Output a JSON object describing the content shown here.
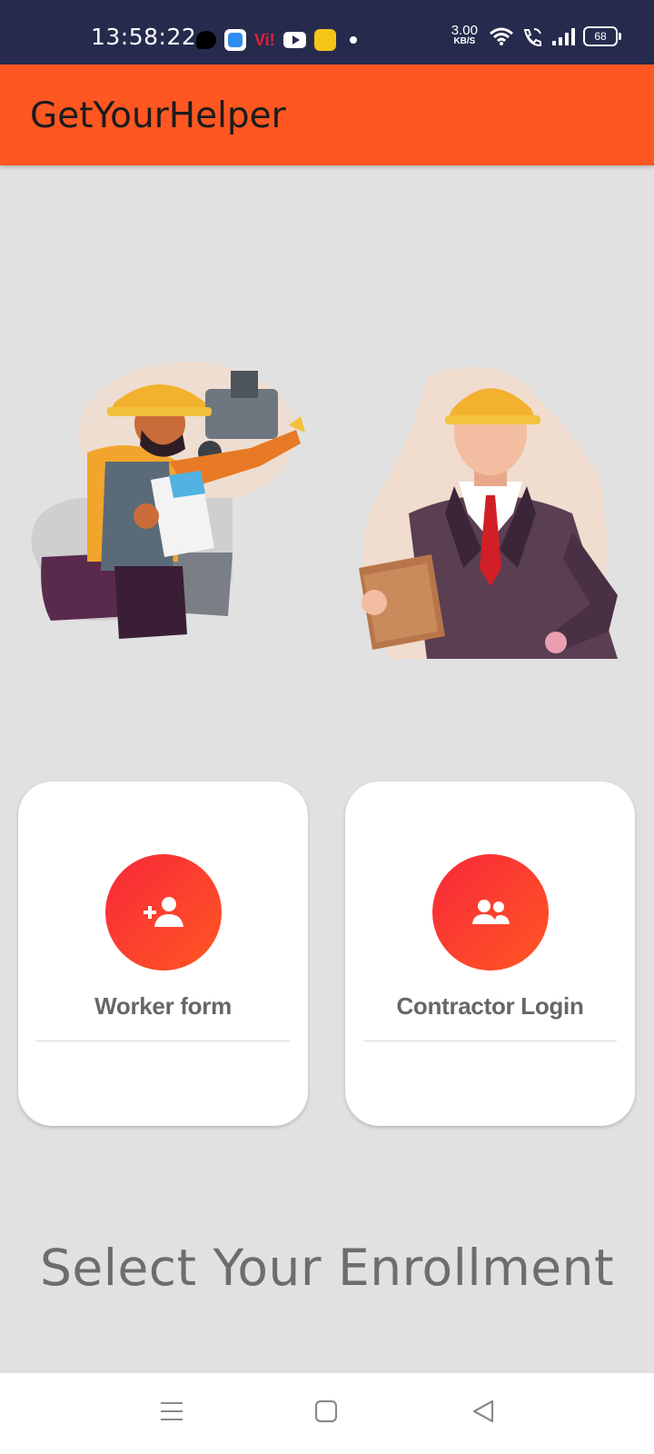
{
  "status_bar": {
    "time": "13:58:22",
    "vi_label": "Vi!",
    "net_speed_value": "3.00",
    "net_speed_unit": "KB/S",
    "battery": "68",
    "icons": [
      "chat-icon",
      "blue-app-icon",
      "vi-icon",
      "youtube-icon",
      "yellow-app-icon",
      "dot-icon",
      "wifi-icon",
      "wifi-calling-icon",
      "signal-icon",
      "battery-icon"
    ]
  },
  "app_bar": {
    "title": "GetYourHelper",
    "color": "#ff5722"
  },
  "illustrations": {
    "worker": "worker-illustration",
    "contractor": "contractor-illustration"
  },
  "cards": [
    {
      "label": "Worker form",
      "icon": "add-person-icon"
    },
    {
      "label": "Contractor Login",
      "icon": "group-icon"
    }
  ],
  "enroll_title": "Select Your Enrollment",
  "nav_bar": {
    "icons": [
      "menu-icon",
      "home-icon",
      "back-icon"
    ]
  },
  "colors": {
    "status_bar": "#262b4e",
    "accent": "#ff5722",
    "gradient_start": "#f8283a",
    "background": "#e1e1e1"
  }
}
